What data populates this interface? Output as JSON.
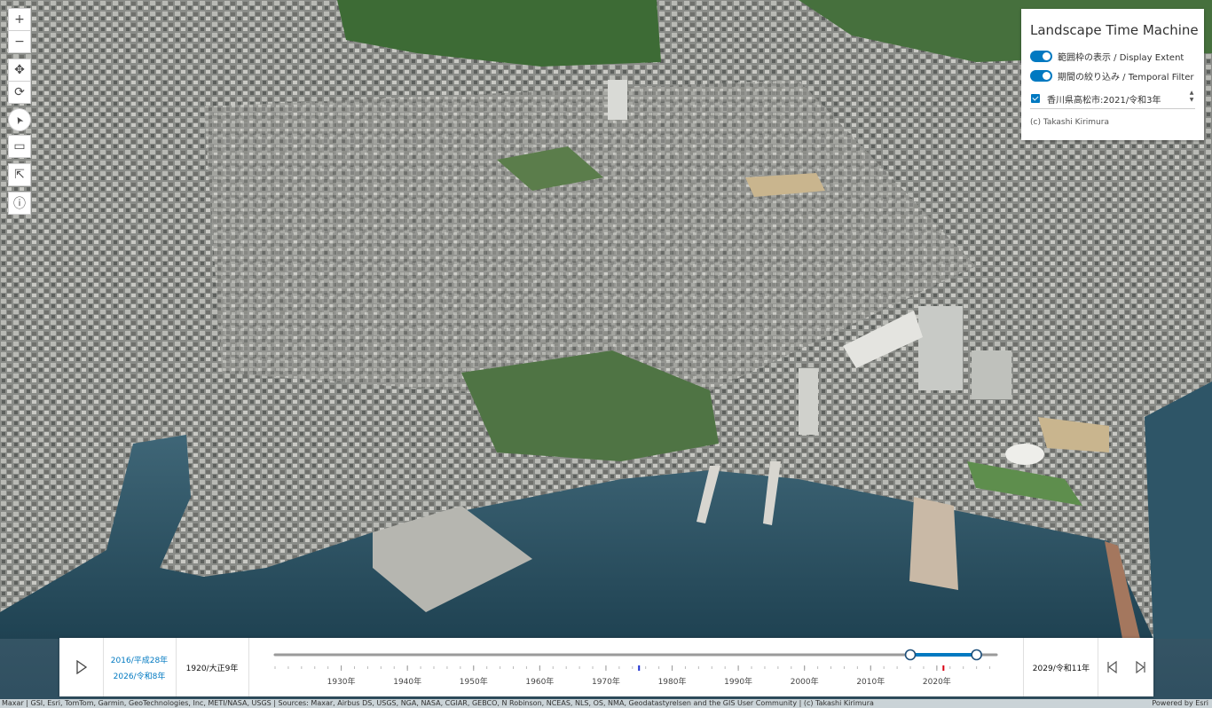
{
  "map": {
    "description_note": ""
  },
  "toolbar": {
    "tools": [
      {
        "icon": "plus-icon",
        "glyph": "+"
      },
      {
        "icon": "minus-icon",
        "glyph": "−"
      },
      {
        "icon": "pan-icon",
        "glyph": "✥"
      },
      {
        "icon": "rotate-icon",
        "glyph": "⟳"
      },
      {
        "icon": "select-icon",
        "glyph": "➤"
      },
      {
        "icon": "measure-icon",
        "glyph": "▭"
      },
      {
        "icon": "share-icon",
        "glyph": "⇱"
      },
      {
        "icon": "info-icon",
        "glyph": "ⓘ"
      }
    ]
  },
  "panel": {
    "title": "Landscape Time Machine",
    "toggle_extent": "範囲枠の表示 / Display Extent",
    "toggle_temporal": "期間の絞り込み / Temporal Filter",
    "layer_label": "香川県高松市:2021/令和3年",
    "credit": "(c) Takashi Kirimura"
  },
  "timeslider": {
    "current_start": "2016/平成28年",
    "current_end": "2026/令和8年",
    "min_label": "1920/大正9年",
    "max_label": "2029/令和11年",
    "min_year": 1920,
    "max_year": 2029,
    "range_start_year": 2016,
    "range_end_year": 2026,
    "marker_blue_year": 1975,
    "marker_red_year": 2021,
    "ticks": [
      {
        "label": "1930年",
        "year": 1930
      },
      {
        "label": "1940年",
        "year": 1940
      },
      {
        "label": "1950年",
        "year": 1950
      },
      {
        "label": "1960年",
        "year": 1960
      },
      {
        "label": "1970年",
        "year": 1970
      },
      {
        "label": "1980年",
        "year": 1980
      },
      {
        "label": "1990年",
        "year": 1990
      },
      {
        "label": "2000年",
        "year": 2000
      },
      {
        "label": "2010年",
        "year": 2010
      },
      {
        "label": "2020年",
        "year": 2020
      }
    ],
    "accent": "#0079c1",
    "red": "#d90012"
  },
  "attribution": {
    "left": "Maxar | GSI, Esri, TomTom, Garmin, GeoTechnologies, Inc, METI/NASA, USGS | Sources: Maxar, Airbus DS, USGS, NGA, NASA, CGIAR, GEBCO, N Robinson, NCEAS, NLS, OS, NMA, Geodatastyrelsen and the GIS User Community | (c) Takashi Kirimura",
    "right": "Powered by Esri"
  }
}
